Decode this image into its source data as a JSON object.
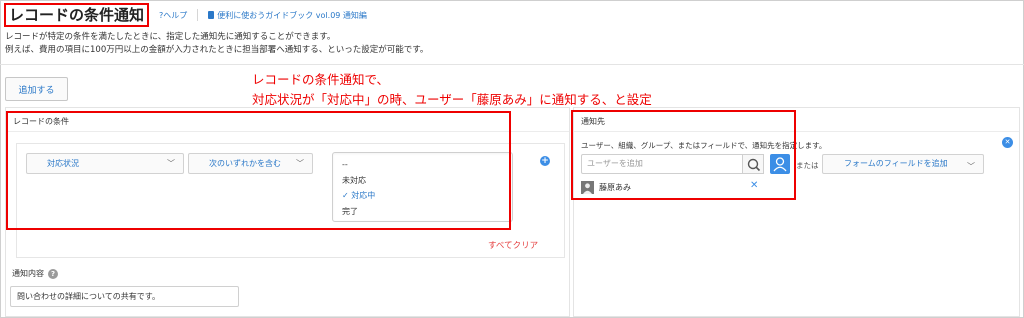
{
  "header": {
    "title": "レコードの条件通知",
    "help": "?ヘルプ",
    "guide": "便利に使おうガイドブック vol.09 通知編"
  },
  "description": {
    "line1": "レコードが特定の条件を満たしたときに、指定した通知先に通知することができます。",
    "line2": "例えば、費用の項目に100万円以上の金額が入力されたときに担当部署へ通知する、といった設定が可能です。"
  },
  "add_button": "追加する",
  "annotation": {
    "line1": "レコードの条件通知で、",
    "line2": "対応状況が「対応中」の時、ユーザー「藤原あみ」に通知する、と設定"
  },
  "conditions": {
    "title": "レコードの条件",
    "field_select": "対応状況",
    "operator_select": "次のいずれかを含む",
    "options": [
      {
        "label": "--",
        "selected": false
      },
      {
        "label": "未対応",
        "selected": false
      },
      {
        "label": "✓ 対応中",
        "selected": true
      },
      {
        "label": "完了",
        "selected": false
      }
    ],
    "clear_all": "すべてクリア"
  },
  "notification_content": {
    "label": "通知内容",
    "value": "問い合わせの詳細についての共有です。"
  },
  "recipients": {
    "title": "通知先",
    "description": "ユーザー、組織、グループ、またはフィールドで、通知先を指定します。",
    "search_placeholder": "ユーザーを追加",
    "or_text": "または",
    "field_button": "フォームのフィールドを追加",
    "users": [
      {
        "name": "藤原あみ"
      }
    ]
  },
  "colors": {
    "accent": "#2a78c8",
    "highlight": "#e00000",
    "clear": "#e54040"
  },
  "icons": {
    "help": "question-icon",
    "guide": "book-icon",
    "plus": "plus-circle-icon",
    "search": "search-icon",
    "user": "user-icon",
    "remove": "close-icon"
  }
}
